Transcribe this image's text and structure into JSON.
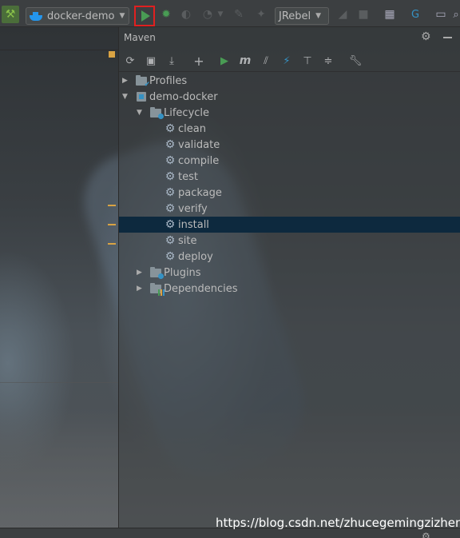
{
  "toolbar": {
    "run_config": "docker-demo",
    "jrebel_config": "JRebel"
  },
  "maven": {
    "title": "Maven",
    "toolbar_icons": [
      "reload-icon",
      "generate-sources-icon",
      "download-icon",
      "add-icon",
      "run-icon",
      "execute-goal-icon",
      "toggle-offline-icon",
      "skip-tests-icon",
      "show-dependencies-icon",
      "collapse-all-icon",
      "settings-wrench-icon"
    ],
    "tree": {
      "profiles": "Profiles",
      "project": "demo-docker",
      "lifecycle": "Lifecycle",
      "goals": [
        "clean",
        "validate",
        "compile",
        "test",
        "package",
        "verify",
        "install",
        "site",
        "deploy"
      ],
      "selected_goal": "install",
      "plugins": "Plugins",
      "dependencies": "Dependencies"
    }
  },
  "watermark": "https://blog.csdn.net/zhucegemingzizheng",
  "colors": {
    "selection": "#0d293e",
    "run_green": "#499c54",
    "highlight_red": "#e02020",
    "docker_blue": "#2496ed"
  }
}
